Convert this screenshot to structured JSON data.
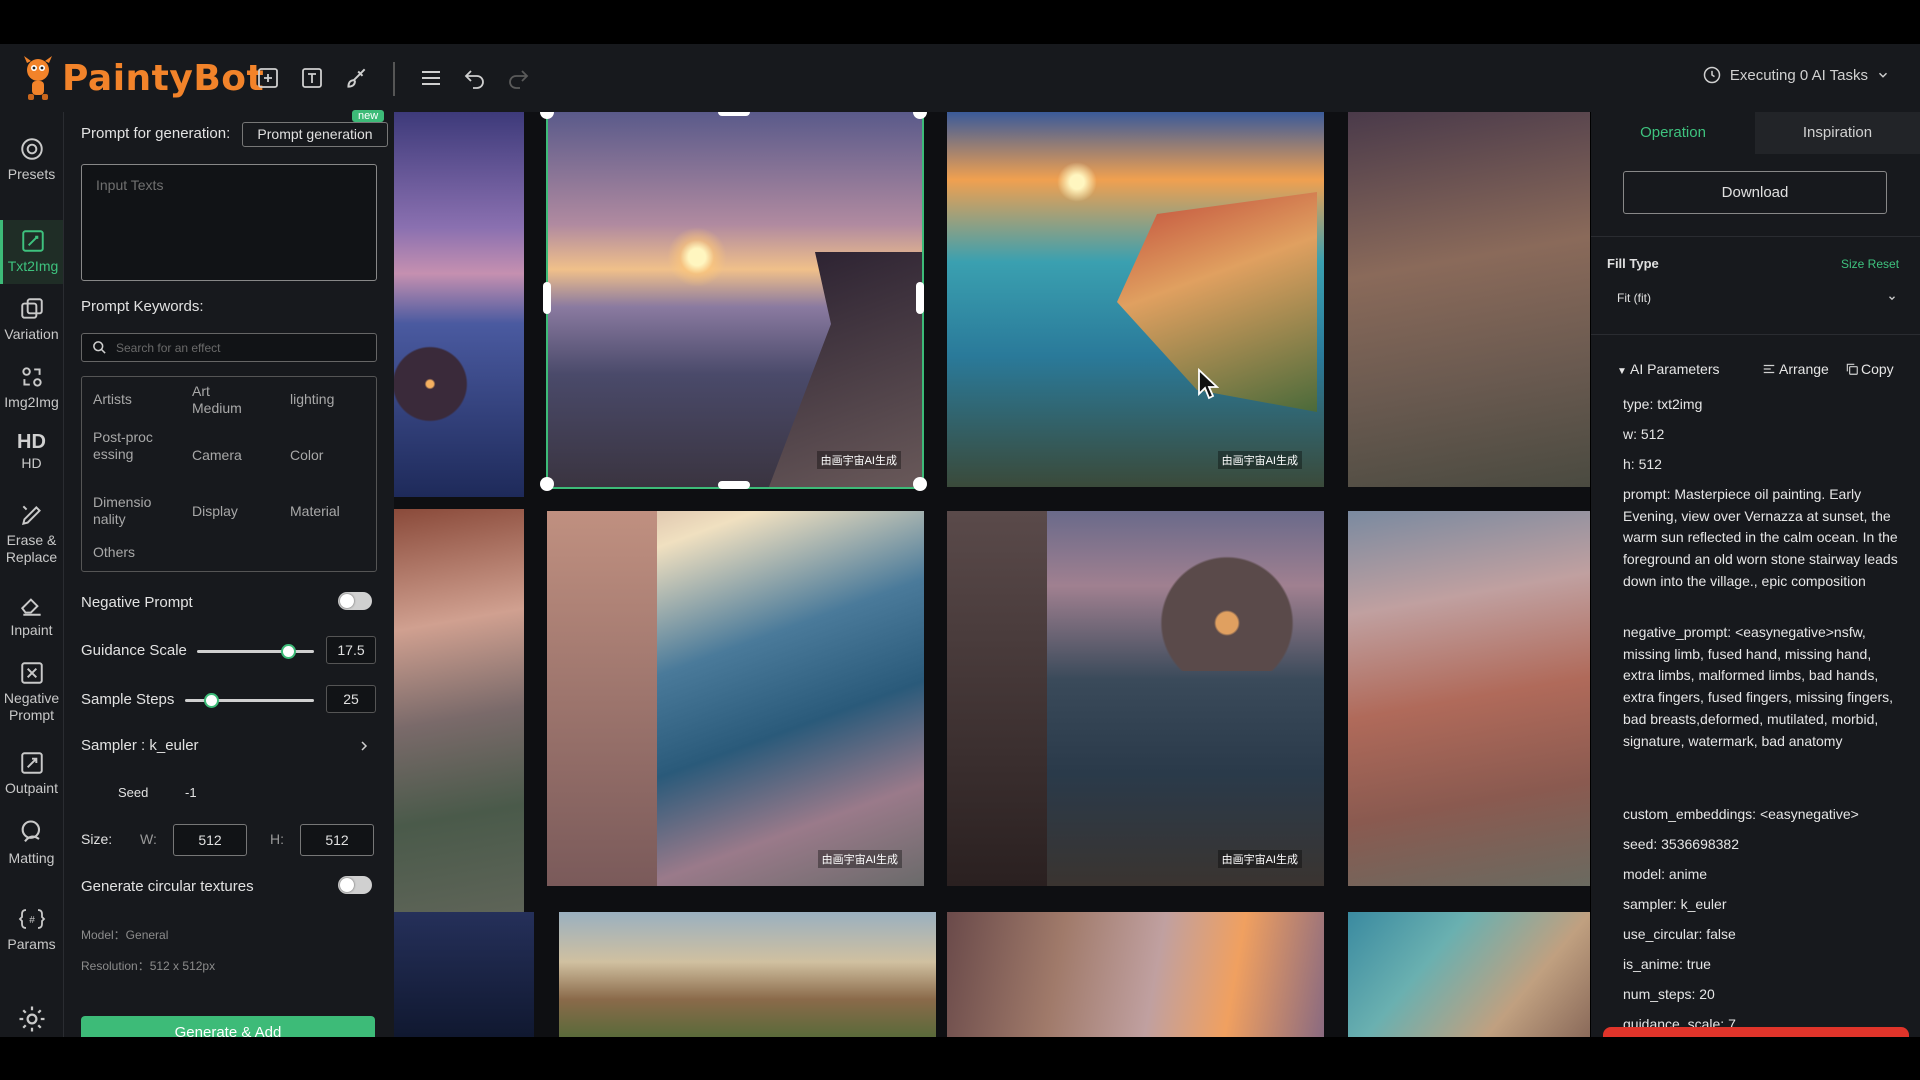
{
  "app": {
    "name": "PaintyBot"
  },
  "header": {
    "executing": "Executing 0 AI Tasks"
  },
  "sidebar": {
    "items": [
      {
        "label": "Presets"
      },
      {
        "label": "Txt2Img"
      },
      {
        "label": "Variation"
      },
      {
        "label": "Img2Img"
      },
      {
        "label": "HD",
        "icon_text": "HD"
      },
      {
        "label": "Erase & Replace"
      },
      {
        "label": "Inpaint"
      },
      {
        "label": "Negative Prompt"
      },
      {
        "label": "Outpaint"
      },
      {
        "label": "Matting"
      },
      {
        "label": "Params"
      }
    ]
  },
  "left": {
    "prompt_label": "Prompt for generation:",
    "prompt_generation_button": "Prompt generation",
    "new_tag": "new",
    "input_placeholder": "Input Texts",
    "keywords_label": "Prompt Keywords:",
    "search_placeholder": "Search for an effect",
    "keywords": {
      "artists": "Artists",
      "art_medium": "Art Medium",
      "lighting": "lighting",
      "post_processing": "Post-processing",
      "camera": "Camera",
      "color": "Color",
      "dimensionality": "Dimensionality",
      "display": "Display",
      "material": "Material",
      "others": "Others"
    },
    "negative_prompt": "Negative Prompt",
    "guidance_scale": {
      "label": "Guidance Scale",
      "value": "17.5",
      "level": 0.78
    },
    "sample_steps": {
      "label": "Sample Steps",
      "value": "25",
      "level": 0.2
    },
    "sampler": "Sampler : k_euler",
    "seed_label": "Seed",
    "seed_value": "-1",
    "size_label": "Size:",
    "w_label": "W:",
    "w_value": "512",
    "h_label": "H:",
    "h_value": "512",
    "circular": "Generate circular textures",
    "model": "Model：General",
    "resolution": "Resolution：512 x 512px",
    "generate_button": "Generate & Add"
  },
  "gallery": {
    "watermark": "由画宇宙AI生成"
  },
  "right": {
    "tabs": {
      "operation": "Operation",
      "inspiration": "Inspiration"
    },
    "download": "Download",
    "fill_type_label": "Fill Type",
    "size_reset": "Size Reset",
    "fill_value": "Fit (fit)",
    "ai_params": "AI Parameters",
    "arrange": "Arrange",
    "copy": "Copy",
    "params": {
      "type": "type:  txt2img",
      "w": "w:  512",
      "h": "h:  512",
      "prompt": "prompt:  Masterpiece oil painting. Early Evening, view over Vernazza at sunset, the warm sun reflected in the calm ocean. In the foreground an old worn stone stairway leads down into the village., epic composition",
      "negative_prompt": "negative_prompt:  <easynegative>nsfw, missing limb, fused hand, missing hand, extra limbs, malformed limbs, bad hands, extra fingers, fused fingers, missing fingers, bad breasts,deformed, mutilated, morbid, signature, watermark,  bad anatomy",
      "custom_embeddings": "custom_embeddings:  <easynegative>",
      "seed": "seed:  3536698382",
      "model": "model:  anime",
      "sampler": "sampler:  k_euler",
      "use_circular": "use_circular:  false",
      "is_anime": "is_anime:  true",
      "num_steps": "num_steps:  20",
      "guidance_scale": "guidance_scale:  7"
    }
  },
  "colors": {
    "accent": "#3dbb78",
    "brand": "#f2832a",
    "panel": "#17191d"
  }
}
